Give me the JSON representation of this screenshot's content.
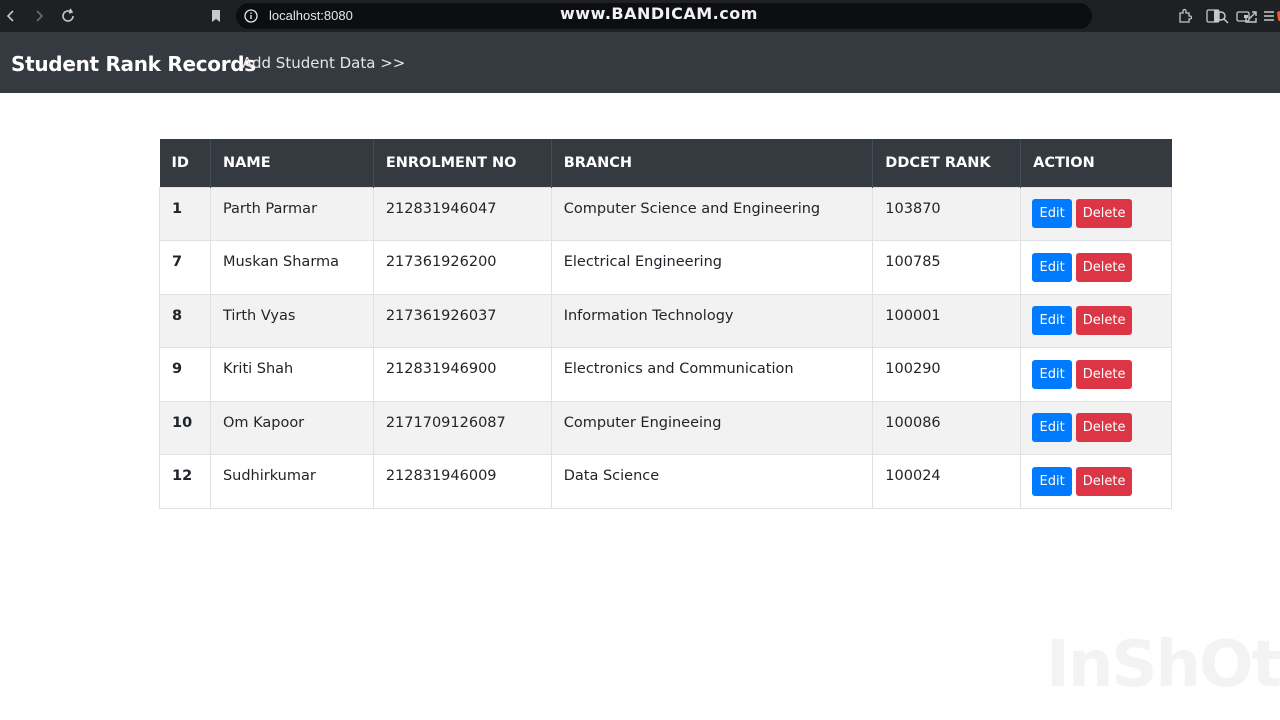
{
  "browser": {
    "url": "localhost:8080",
    "recorder_watermark": "www.BANDICAM.com",
    "rewards_badge": "1"
  },
  "navbar": {
    "brand": "Student Rank Records",
    "add_link": "Add Student Data >>"
  },
  "table": {
    "headers": [
      "ID",
      "NAME",
      "ENROLMENT NO",
      "BRANCH",
      "DDCET RANK",
      "ACTION"
    ],
    "rows": [
      {
        "id": "1",
        "name": "Parth Parmar",
        "enrolment": "212831946047",
        "branch": "Computer Science and Engineering",
        "rank": "103870"
      },
      {
        "id": "7",
        "name": "Muskan Sharma",
        "enrolment": "217361926200",
        "branch": "Electrical Engineering",
        "rank": "100785"
      },
      {
        "id": "8",
        "name": "Tirth Vyas",
        "enrolment": "217361926037",
        "branch": "Information Technology",
        "rank": "100001"
      },
      {
        "id": "9",
        "name": "Kriti Shah",
        "enrolment": "212831946900",
        "branch": "Electronics and Communication",
        "rank": "100290"
      },
      {
        "id": "10",
        "name": "Om Kapoor",
        "enrolment": "2171709126087",
        "branch": "Computer Engineeing",
        "rank": "100086"
      },
      {
        "id": "12",
        "name": "Sudhirkumar",
        "enrolment": "212831946009",
        "branch": "Data Science",
        "rank": "100024"
      }
    ],
    "edit_label": "Edit",
    "delete_label": "Delete"
  },
  "overlay_watermark": "InShOt",
  "colors": {
    "navbar_bg": "#343a40",
    "edit_btn": "#007bff",
    "delete_btn": "#dc3545",
    "row_stripe": "#f2f2f2"
  }
}
